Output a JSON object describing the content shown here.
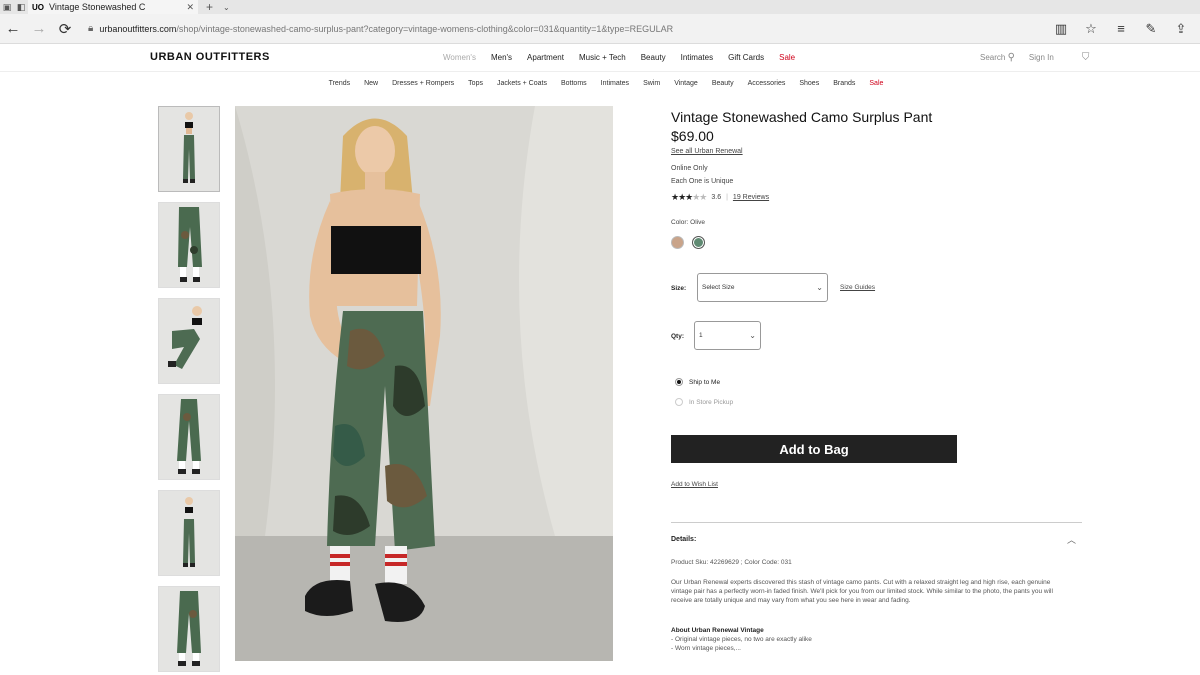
{
  "browser": {
    "tab_title": "Vintage Stonewashed C",
    "tab_favicon": "UO",
    "url_host": "urbanoutfitters.com",
    "url_path": "/shop/vintage-stonewashed-camo-surplus-pant?category=vintage-womens-clothing&color=031&quantity=1&type=REGULAR"
  },
  "site": {
    "logo": "URBAN OUTFITTERS",
    "main_nav": [
      "Women's",
      "Men's",
      "Apartment",
      "Music + Tech",
      "Beauty",
      "Intimates",
      "Gift Cards",
      "Sale"
    ],
    "search_label": "Search",
    "signin_label": "Sign In",
    "sub_nav": [
      "Trends",
      "New",
      "Dresses + Rompers",
      "Tops",
      "Jackets + Coats",
      "Bottoms",
      "Intimates",
      "Swim",
      "Vintage",
      "Beauty",
      "Accessories",
      "Shoes",
      "Brands",
      "Sale"
    ]
  },
  "product": {
    "title": "Vintage Stonewashed Camo Surplus Pant",
    "price": "$69.00",
    "brand_link": "See all Urban Renewal",
    "online_only": "Online Only",
    "unique": "Each One is Unique",
    "rating": "3.6",
    "rating_stars": 3.6,
    "reviews": "19 Reviews",
    "color_label": "Color: Olive",
    "size_label": "Size:",
    "size_value": "Select Size",
    "size_guide": "Size Guides",
    "qty_label": "Qty:",
    "qty_value": "1",
    "ship_to_me": "Ship to Me",
    "in_store": "In Store Pickup",
    "add_to_bag": "Add to Bag",
    "wish_list": "Add to Wish List",
    "details_title": "Details:",
    "sku": "Product Sku: 42269629 ; Color Code: 031",
    "description": "Our Urban Renewal experts discovered this stash of vintage camo pants. Cut with a relaxed straight leg and high rise, each genuine vintage pair has a perfectly worn-in faded finish. We'll pick for you from our limited stock. While similar to the photo, the pants you will receive are totally unique and may vary from what you see here in wear and fading.",
    "about_title": "About Urban Renewal Vintage",
    "about_1": "- Original vintage pieces, no two are exactly alike",
    "about_2": "- Worn vintage pieces,..."
  },
  "colors": {
    "accent": "#d0021b",
    "button": "#222222",
    "swatch_1": "#c9a48a",
    "swatch_2": "#5f8a72"
  }
}
